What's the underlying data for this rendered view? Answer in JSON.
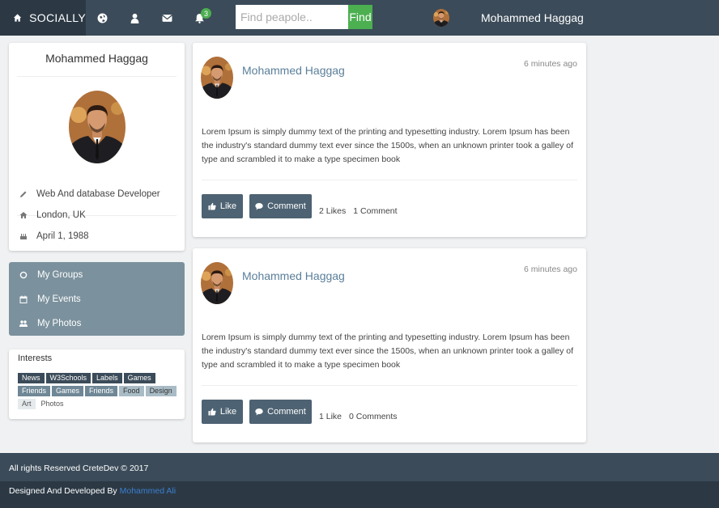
{
  "navbar": {
    "brand": "SOCIALLY",
    "notification_count": "3",
    "search_placeholder": "Find peapole..",
    "find_label": "Find",
    "user_name": "Mohammed Haggag"
  },
  "profile": {
    "name": "Mohammed Haggag",
    "job": "Web And database Developer",
    "location": "London, UK",
    "birthday": "April 1, 1988"
  },
  "menu": {
    "items": [
      {
        "label": "My Groups",
        "icon": "circle-icon"
      },
      {
        "label": "My Events",
        "icon": "calendar-icon"
      },
      {
        "label": "My Photos",
        "icon": "users-icon"
      }
    ]
  },
  "interests": {
    "title": "Interests",
    "tags": [
      "News",
      "W3Schools",
      "Labels",
      "Games",
      "Friends",
      "Games",
      "Friends",
      "Food",
      "Design",
      "Art",
      "Photos"
    ]
  },
  "posts": [
    {
      "author": "Mohammed Haggag",
      "time": "6 minutes ago",
      "text": "Lorem Ipsum is simply dummy text of the printing and typesetting industry. Lorem Ipsum has been the industry's standard dummy text ever since the 1500s, when an unknown printer took a galley of type and scrambled it to make a type specimen book",
      "like_label": "Like",
      "comment_label": "Comment",
      "likes": "2 Likes",
      "comments": "1 Comment"
    },
    {
      "author": "Mohammed Haggag",
      "time": "6 minutes ago",
      "text": "Lorem Ipsum is simply dummy text of the printing and typesetting industry. Lorem Ipsum has been the industry's standard dummy text ever since the 1500s, when an unknown printer took a galley of type and scrambled it to make a type specimen book",
      "like_label": "Like",
      "comment_label": "Comment",
      "likes": "1 Like",
      "comments": "0 Comments"
    }
  ],
  "footer": {
    "rights": "All rights Reserved CreteDev © 2017",
    "designed_by": "Designed And Developed By",
    "author_link": "Mohammed Ali"
  },
  "colors": {
    "navbar": "#3b4b59",
    "brand_bg": "#2c3945",
    "accent_green": "#4caf50",
    "menu_bg": "#7b919d",
    "button": "#4d6272",
    "author_link": "#5a7f9a",
    "footer_link": "#3a7fcf"
  }
}
